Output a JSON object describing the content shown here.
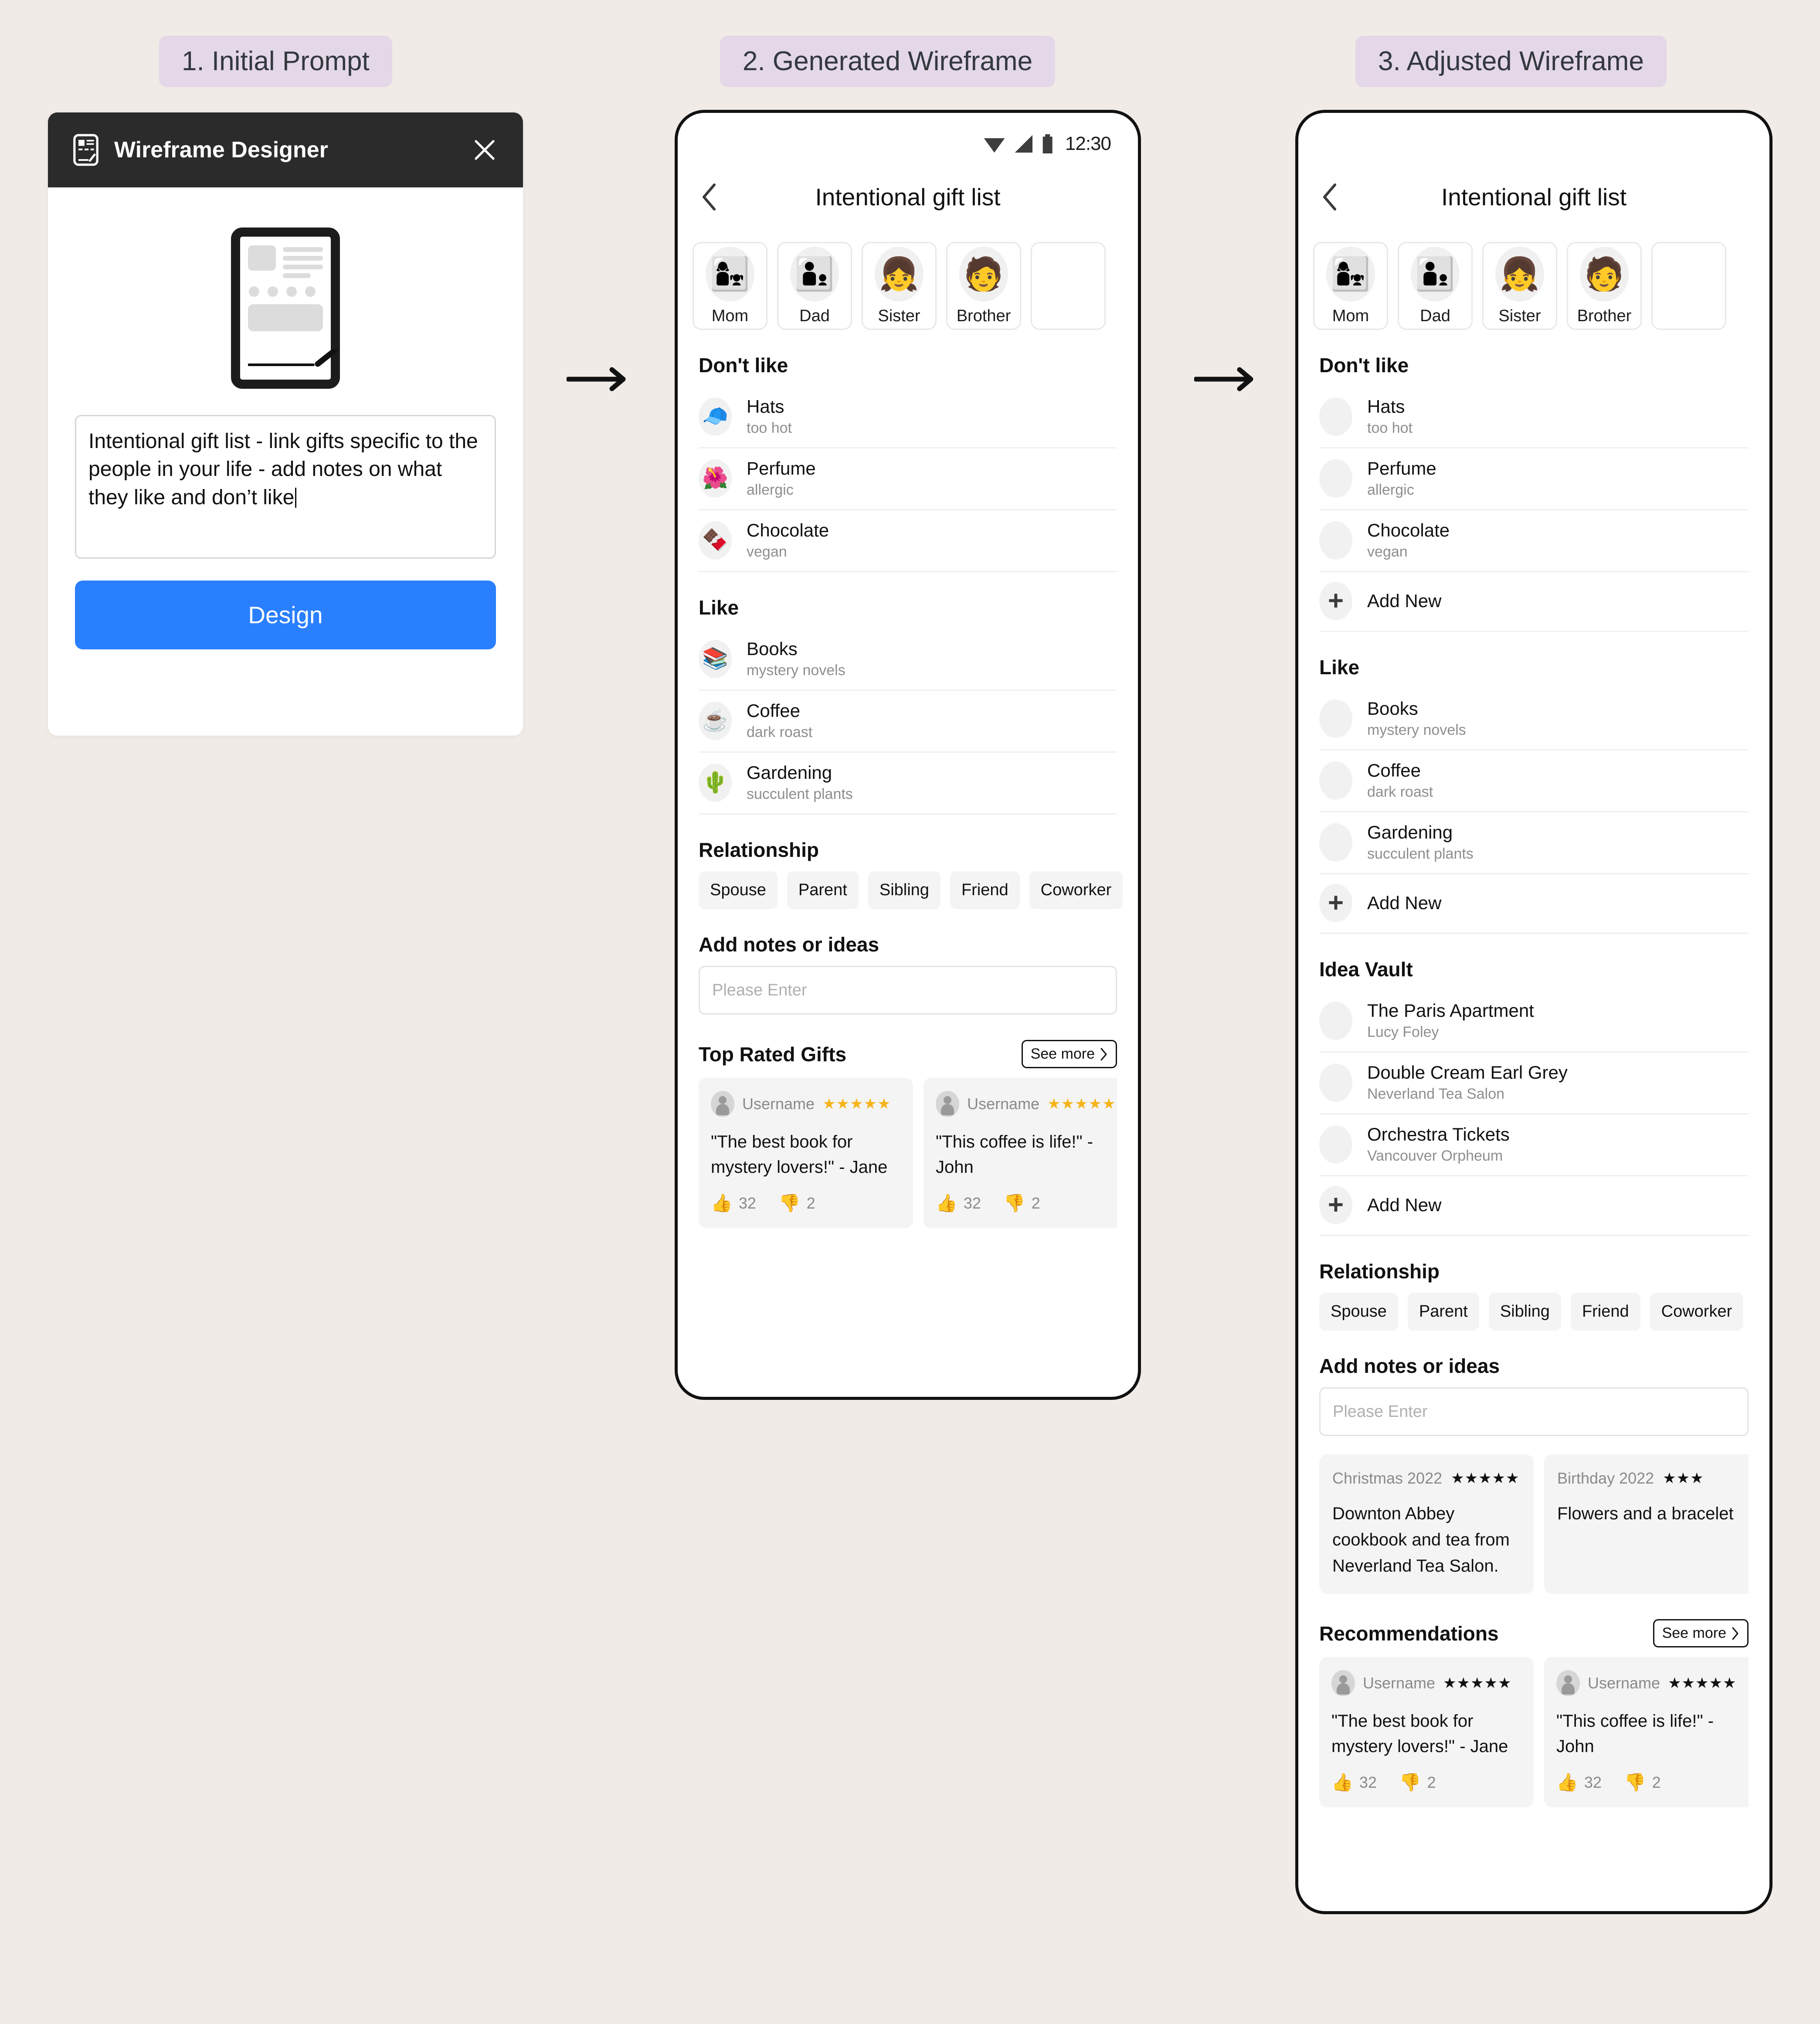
{
  "steps": [
    {
      "label": "1. Initial Prompt"
    },
    {
      "label": "2. Generated Wireframe"
    },
    {
      "label": "3. Adjusted Wireframe"
    }
  ],
  "prompt_card": {
    "app_title": "Wireframe Designer",
    "close_icon": "close-icon",
    "app_icon": "wireframe-document-icon",
    "prompt_text": "Intentional gift list - link gifts specific to the people in your life - add notes on what they like and don’t like",
    "design_button": "Design"
  },
  "phone2": {
    "status": {
      "time": "12:30",
      "wifi": "wifi-icon",
      "signal": "signal-icon",
      "battery": "battery-icon"
    },
    "nav": {
      "back_icon": "chevron-left-icon",
      "title": "Intentional gift list"
    },
    "people": [
      {
        "name": "Mom",
        "emoji": "👩‍👧"
      },
      {
        "name": "Dad",
        "emoji": "👨‍👦"
      },
      {
        "name": "Sister",
        "emoji": "👧"
      },
      {
        "name": "Brother",
        "emoji": "🧑"
      }
    ],
    "dont_like": {
      "title": "Don't like",
      "items": [
        {
          "title": "Hats",
          "sub": "too hot",
          "emoji": "🧢"
        },
        {
          "title": "Perfume",
          "sub": "allergic",
          "emoji": "🌺"
        },
        {
          "title": "Chocolate",
          "sub": "vegan",
          "emoji": "🍫"
        }
      ]
    },
    "like": {
      "title": "Like",
      "items": [
        {
          "title": "Books",
          "sub": "mystery novels",
          "emoji": "📚"
        },
        {
          "title": "Coffee",
          "sub": "dark roast",
          "emoji": "☕"
        },
        {
          "title": "Gardening",
          "sub": "succulent plants",
          "emoji": "🌵"
        }
      ]
    },
    "relationship": {
      "title": "Relationship",
      "chips": [
        "Spouse",
        "Parent",
        "Sibling",
        "Friend",
        "Coworker"
      ]
    },
    "notes": {
      "title": "Add notes or ideas",
      "placeholder": "Please Enter",
      "value": ""
    },
    "top_rated": {
      "title": "Top Rated Gifts",
      "see_more": "See more",
      "cards": [
        {
          "user": "Username",
          "stars": "★★★★★",
          "quote": "\"The best book for mystery lovers!\" - Jane",
          "up": "32",
          "down": "2"
        },
        {
          "user": "Username",
          "stars": "★★★★★",
          "quote": "\"This coffee is life!\" - John",
          "up": "32",
          "down": "2"
        }
      ]
    }
  },
  "phone3": {
    "nav": {
      "back_icon": "chevron-left-icon",
      "title": "Intentional gift list"
    },
    "people": [
      {
        "name": "Mom",
        "emoji": "👩‍👧"
      },
      {
        "name": "Dad",
        "emoji": "👨‍👦"
      },
      {
        "name": "Sister",
        "emoji": "👧"
      },
      {
        "name": "Brother",
        "emoji": "🧑"
      }
    ],
    "dont_like": {
      "title": "Don't like",
      "items": [
        {
          "title": "Hats",
          "sub": "too hot"
        },
        {
          "title": "Perfume",
          "sub": "allergic"
        },
        {
          "title": "Chocolate",
          "sub": "vegan"
        }
      ],
      "add_new": "Add New"
    },
    "like": {
      "title": "Like",
      "items": [
        {
          "title": "Books",
          "sub": "mystery novels"
        },
        {
          "title": "Coffee",
          "sub": "dark roast"
        },
        {
          "title": "Gardening",
          "sub": "succulent plants"
        }
      ],
      "add_new": "Add New"
    },
    "idea_vault": {
      "title": "Idea Vault",
      "items": [
        {
          "title": "The Paris Apartment",
          "sub": "Lucy Foley"
        },
        {
          "title": "Double Cream Earl Grey",
          "sub": "Neverland Tea Salon"
        },
        {
          "title": "Orchestra Tickets",
          "sub": "Vancouver Orpheum"
        }
      ],
      "add_new": "Add New"
    },
    "relationship": {
      "title": "Relationship",
      "chips": [
        "Spouse",
        "Parent",
        "Sibling",
        "Friend",
        "Coworker"
      ]
    },
    "notes": {
      "title": "Add notes or ideas",
      "placeholder": "Please Enter",
      "value": ""
    },
    "gift_history": [
      {
        "label": "Christmas 2022",
        "stars": "★★★★★",
        "body": "Downton Abbey cookbook and tea from Neverland Tea Salon."
      },
      {
        "label": "Birthday 2022",
        "stars": "★★★",
        "body": "Flowers and a bracelet"
      }
    ],
    "recommendations": {
      "title": "Recommendations",
      "see_more": "See more",
      "cards": [
        {
          "user": "Username",
          "stars": "★★★★★",
          "quote": "\"The best book for mystery lovers!\" - Jane",
          "up": "32",
          "down": "2"
        },
        {
          "user": "Username",
          "stars": "★★★★★",
          "quote": "\"This coffee is life!\" - John",
          "up": "32",
          "down": "2"
        }
      ]
    }
  },
  "colors": {
    "background": "#f0ebe6",
    "chip": "#e3d7e8",
    "accent_blue": "#2a7fff",
    "titlebar": "#2b2b2b",
    "star_gold": "#f5b51a"
  }
}
